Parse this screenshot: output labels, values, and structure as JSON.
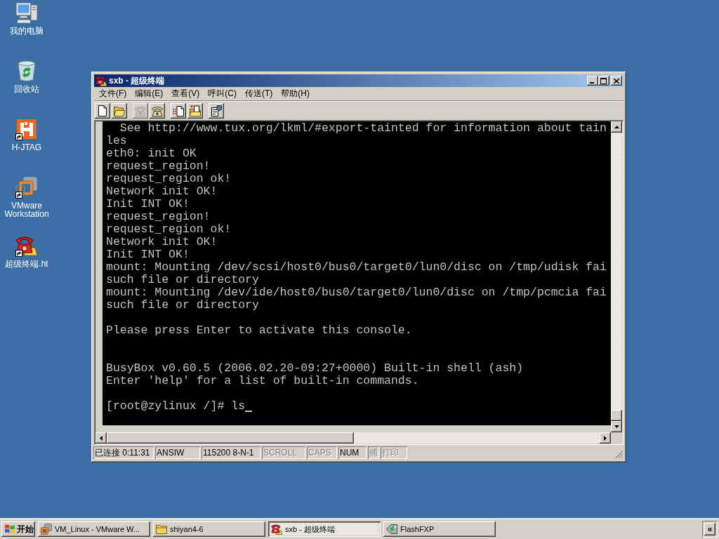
{
  "desktop_icons": [
    {
      "label": "我的电脑",
      "shortcut": false
    },
    {
      "label": "回收站",
      "shortcut": false
    },
    {
      "label": "H-JTAG",
      "shortcut": true
    },
    {
      "label": "VMware Workstation",
      "shortcut": true
    },
    {
      "label": "超级终端.ht",
      "shortcut": true
    }
  ],
  "window": {
    "title": "sxb - 超级终端",
    "active": true
  },
  "menu": [
    "文件(F)",
    "编辑(E)",
    "查看(V)",
    "呼叫(C)",
    "传送(T)",
    "帮助(H)"
  ],
  "toolbar": [
    [
      {
        "disabled": false
      },
      {
        "disabled": false
      }
    ],
    [
      {
        "disabled": true
      },
      {
        "disabled": false
      }
    ],
    [
      {
        "disabled": false
      },
      {
        "disabled": false
      }
    ],
    [
      {
        "disabled": false
      }
    ]
  ],
  "terminal": {
    "lines": [
      {
        "kind": "output",
        "text": "  See http://www.tux.org/lkml/#export-tainted for information about tain"
      },
      {
        "kind": "output",
        "text": "les"
      },
      {
        "kind": "output",
        "text": "eth0: init OK"
      },
      {
        "kind": "output",
        "text": "request_region!"
      },
      {
        "kind": "output",
        "text": "request_region ok!"
      },
      {
        "kind": "output",
        "text": "Network init OK!"
      },
      {
        "kind": "output",
        "text": "Init INT OK!"
      },
      {
        "kind": "output",
        "text": "request_region!"
      },
      {
        "kind": "output",
        "text": "request_region ok!"
      },
      {
        "kind": "output",
        "text": "Network init OK!"
      },
      {
        "kind": "output",
        "text": "Init INT OK!"
      },
      {
        "kind": "output",
        "text": "mount: Mounting /dev/scsi/host0/bus0/target0/lun0/disc on /tmp/udisk fai"
      },
      {
        "kind": "output",
        "text": "such file or directory"
      },
      {
        "kind": "output",
        "text": "mount: Mounting /dev/ide/host0/bus0/target0/lun0/disc on /tmp/pcmcia fai"
      },
      {
        "kind": "output",
        "text": "such file or directory"
      },
      {
        "kind": "blank"
      },
      {
        "kind": "output",
        "text": "Please press Enter to activate this console."
      },
      {
        "kind": "blank"
      },
      {
        "kind": "blank"
      },
      {
        "kind": "output",
        "text": "BusyBox v0.60.5 (2006.02.20-09:27+0000) Built-in shell (ash)"
      },
      {
        "kind": "output",
        "text": "Enter 'help' for a list of built-in commands."
      },
      {
        "kind": "blank"
      },
      {
        "kind": "prompt",
        "text": "[root@zylinux /]# ls",
        "cursor": true
      }
    ]
  },
  "status_bar": [
    {
      "text": "已连接 0:11:31",
      "disabled": false
    },
    {
      "text": "ANSIW",
      "disabled": false
    },
    {
      "text": "115200 8-N-1",
      "disabled": false
    },
    {
      "text": "SCROLL",
      "disabled": true
    },
    {
      "text": "CAPS",
      "disabled": true
    },
    {
      "text": "NUM",
      "disabled": false
    },
    {
      "text": "捕",
      "disabled": true
    },
    {
      "text": "打印",
      "disabled": true
    }
  ],
  "taskbar": {
    "start": "开始",
    "tasks": [
      {
        "label": "VM_Linux - VMware W...",
        "selected": false
      },
      {
        "label": "shiyan4-6",
        "selected": false
      },
      {
        "label": "sxb - 超级终端",
        "selected": true
      },
      {
        "label": "FlashFXP",
        "selected": false
      }
    ],
    "tray_toggle": "«"
  }
}
